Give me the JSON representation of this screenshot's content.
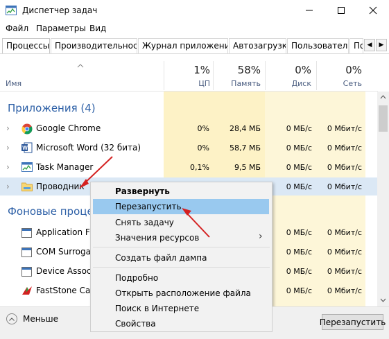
{
  "window": {
    "title": "Диспетчер задач"
  },
  "menu": [
    "Файл",
    "Параметры",
    "Вид"
  ],
  "tabs": [
    "Процессы",
    "Производительность",
    "Журнал приложений",
    "Автозагрузка",
    "Пользователи",
    "По"
  ],
  "columns": {
    "name": "Имя",
    "cpu": {
      "pct": "1%",
      "label": "ЦП"
    },
    "memory": {
      "pct": "58%",
      "label": "Память"
    },
    "disk": {
      "pct": "0%",
      "label": "Диск"
    },
    "network": {
      "pct": "0%",
      "label": "Сеть"
    }
  },
  "groups": {
    "apps": "Приложения (4)",
    "background": "Фоновые процес"
  },
  "apps": [
    {
      "name": "Google Chrome",
      "icon": "chrome-icon",
      "cpu": "0%",
      "mem": "28,4 МБ",
      "disk": "0 МБ/с",
      "net": "0 Мбит/с"
    },
    {
      "name": "Microsoft Word (32 бита)",
      "icon": "word-icon",
      "cpu": "0%",
      "mem": "58,7 МБ",
      "disk": "0 МБ/с",
      "net": "0 Мбит/с"
    },
    {
      "name": "Task Manager",
      "icon": "task-manager-icon",
      "cpu": "0,1%",
      "mem": "9,5 МБ",
      "disk": "0 МБ/с",
      "net": "0 Мбит/с"
    },
    {
      "name": "Проводник",
      "icon": "explorer-folder-icon",
      "disk": "0 МБ/с",
      "net": "0 Мбит/с"
    }
  ],
  "background": [
    {
      "name": "Application Fra",
      "icon": "app-frame-icon",
      "disk": "0 МБ/с",
      "net": "0 Мбит/с"
    },
    {
      "name": "COM Surrogate",
      "icon": "com-surrogate-icon",
      "disk": "0 МБ/с",
      "net": "0 Мбит/с"
    },
    {
      "name": "Device Associat",
      "icon": "device-assoc-icon",
      "disk": "0 МБ/с",
      "net": "0 Мбит/с"
    },
    {
      "name": "FastStone Capt",
      "icon": "faststone-icon",
      "disk": "0 МБ/с",
      "net": "0 Мбит/с"
    }
  ],
  "context_menu": [
    {
      "label": "Развернуть",
      "bold": true
    },
    {
      "label": "Перезапустить",
      "selected": true
    },
    {
      "label": "Снять задачу"
    },
    {
      "label": "Значения ресурсов",
      "submenu": true
    },
    {
      "label": "Создать файл дампа"
    },
    {
      "label": "Подробно"
    },
    {
      "label": "Открыть расположение файла"
    },
    {
      "label": "Поиск в Интернете"
    },
    {
      "label": "Свойства"
    }
  ],
  "footer": {
    "less": "Меньше",
    "action_button": "Перезапустить"
  },
  "colors": {
    "group_title": "#2c5fa6",
    "highlight": "#fdf2c6",
    "selection": "#99c9ef",
    "arrow": "#d42020"
  }
}
